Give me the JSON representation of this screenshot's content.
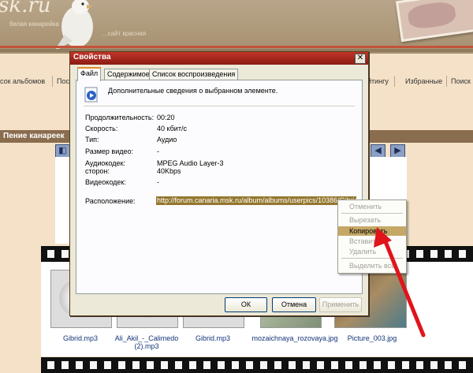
{
  "site": {
    "logo": "sk.ru",
    "slogan": "белая канарейка",
    "slogan2": "...сайт красная",
    "nav": [
      "сок альбомов",
      "Пос.",
      "йтингу",
      "Избранные",
      "Поиск"
    ],
    "section_title": "Пение канареек"
  },
  "dialog": {
    "title": "Свойства",
    "close_label": "✕",
    "tabs": [
      "Файл",
      "Содержимое",
      "Список воспроизведения"
    ],
    "description": "Дополнительные сведения о выбранном элементе.",
    "props": [
      {
        "label": "Продолжительность:",
        "value": "00:20"
      },
      {
        "label": "Скорость:",
        "value": "40 кбит/с"
      },
      {
        "label": "Тип:",
        "value": "Аудио"
      },
      {
        "label": "Размер видео:",
        "value": "-"
      },
      {
        "label": "Аудиокодек:",
        "value": "MPEG Audio Layer-3"
      },
      {
        "label": "сторон:",
        "value": "40Kbps"
      },
      {
        "label": "Видеокодек:",
        "value": "-"
      }
    ],
    "location_label": "Расположение:",
    "location_value": "http://forum.canaria.msk.ru/album/albums/userpics/10386/Gibrid.mp3",
    "buttons": {
      "ok": "ОК",
      "cancel": "Отмена",
      "apply": "Применить"
    }
  },
  "context_menu": {
    "items": [
      "Отменить",
      "Вырезать",
      "Копировать",
      "Вставить",
      "Удалить",
      "Выделить все"
    ],
    "highlighted": "Копировать",
    "highlight_color": "#c5a866"
  },
  "thumbnails": [
    {
      "caption": "Gibrid.mp3",
      "kind": "audio-icon"
    },
    {
      "caption": "Ali_Akil_-_Calimedo (2).mp3",
      "kind": "audio-icon"
    },
    {
      "caption": "Gibrid.mp3",
      "kind": "audio-icon"
    },
    {
      "caption": "mozaichnaya_rozovaya.jpg",
      "kind": "photo"
    },
    {
      "caption": "Picture_003.jpg",
      "kind": "photo"
    }
  ],
  "colors": {
    "accent_red": "#e0141b",
    "titlebar": "#a3261c"
  }
}
